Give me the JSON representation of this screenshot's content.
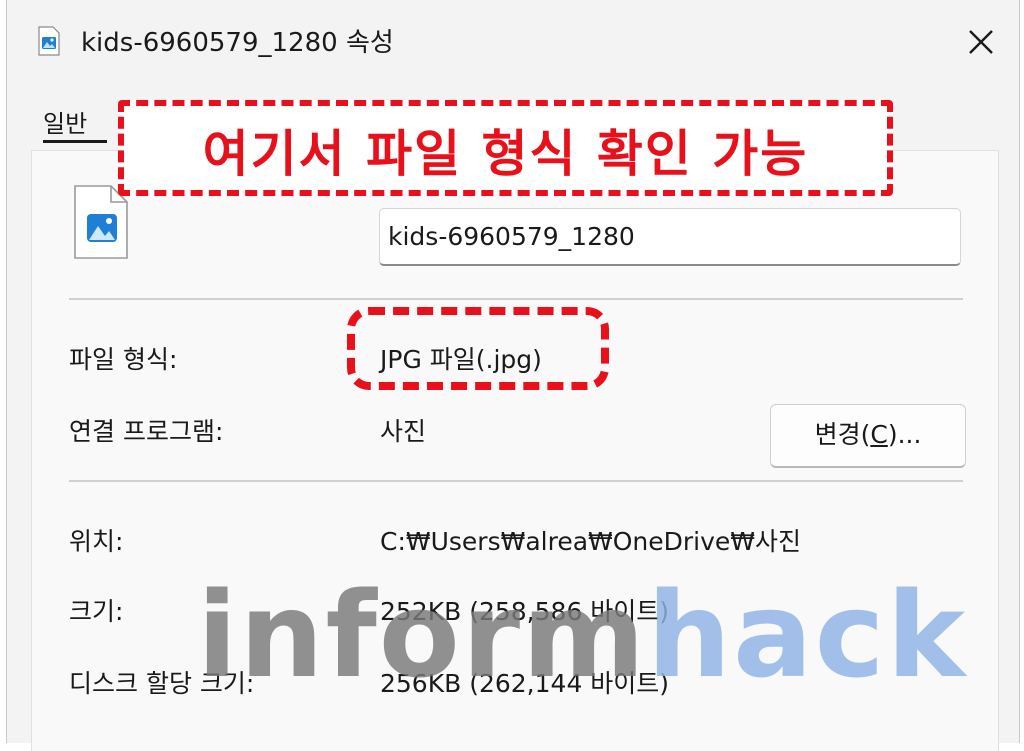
{
  "window": {
    "title": "kids-6960579_1280 속성"
  },
  "tabs": [
    {
      "label": "일반"
    }
  ],
  "callout": {
    "text": "여기서 파일 형식 확인 가능"
  },
  "file": {
    "name": "kids-6960579_1280"
  },
  "properties": {
    "type_label": "파일 형식:",
    "type_value": "JPG 파일(.jpg)",
    "opens_with_label": "연결 프로그램:",
    "opens_with_value": "사진",
    "change_button_prefix": "변경(",
    "change_button_key": "C",
    "change_button_suffix": ")...",
    "location_label": "위치:",
    "location_value": "C:₩Users₩alrea₩OneDrive₩사진",
    "size_label": "크기:",
    "size_value": "252KB (258,586 바이트)",
    "disk_size_label": "디스크 할당 크기:",
    "disk_size_value": "256KB (262,144 바이트)"
  },
  "watermark": {
    "part1": "inform",
    "part2": "hack"
  },
  "colors": {
    "highlight": "#e8111b",
    "watermark_gray": "#7a7a7a",
    "watermark_blue": "#8fb3e6",
    "accent": "#0067c0"
  },
  "icons": {
    "title": "image-file-icon",
    "close": "close-icon",
    "file": "image-file-icon"
  }
}
